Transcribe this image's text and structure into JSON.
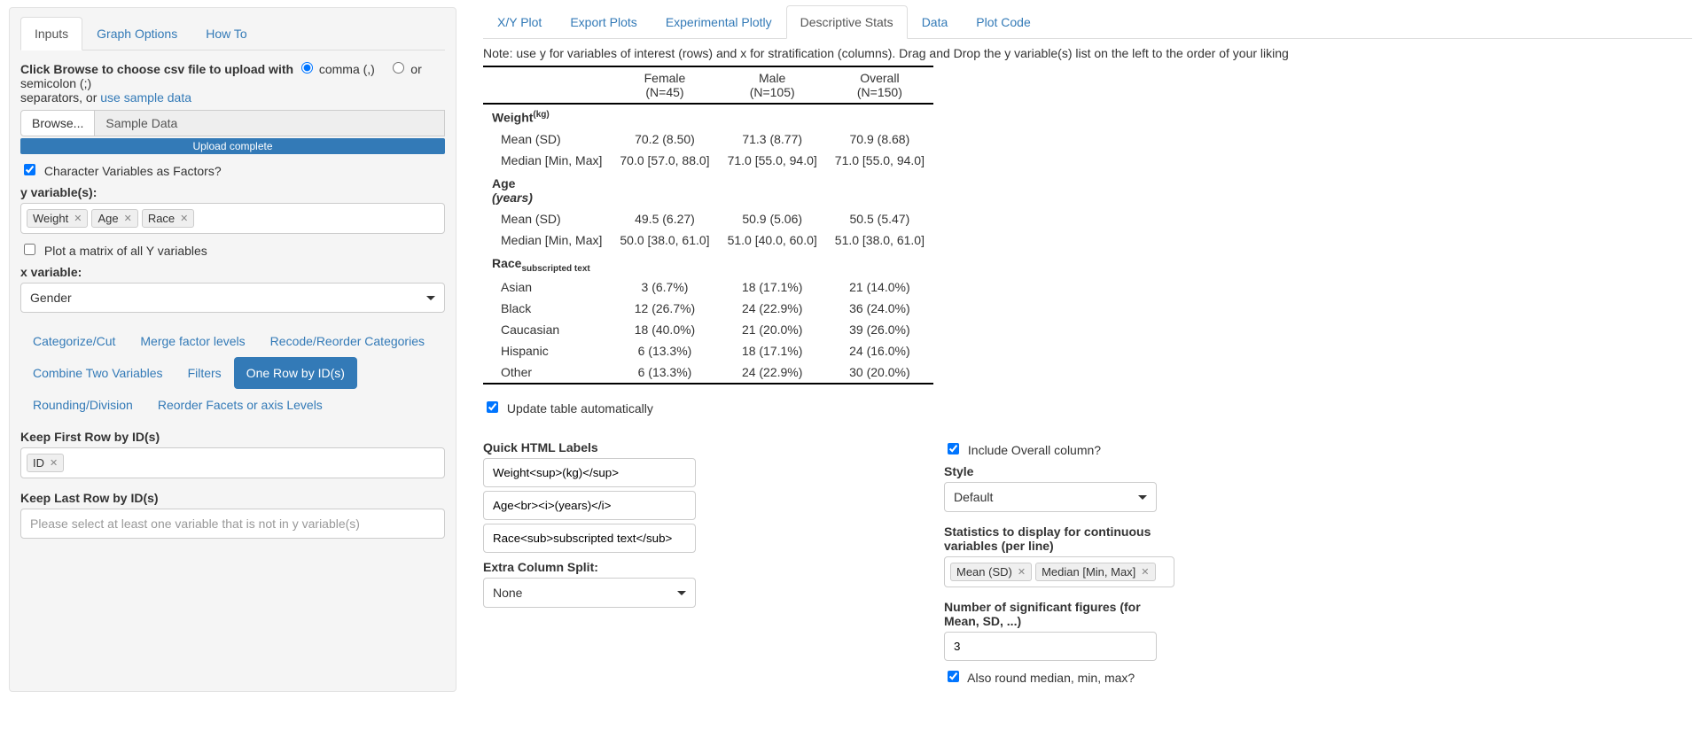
{
  "left": {
    "tabs": {
      "inputs": "Inputs",
      "graph": "Graph Options",
      "howto": "How To"
    },
    "instruction1": "Click Browse to choose csv file to upload with",
    "radio_comma": "comma (,)",
    "radio_semi": "or semicolon (;)",
    "instruction2": "separators, or ",
    "sample_link": "use sample data",
    "browse": "Browse...",
    "sample_data": "Sample Data",
    "upload_status": "Upload complete",
    "chk_factors": "Character Variables as Factors?",
    "yvars_label": "y variable(s):",
    "yvars": [
      "Weight",
      "Age",
      "Race"
    ],
    "chk_matrix": "Plot a matrix of all Y variables",
    "xvar_label": "x variable:",
    "xvar_value": "Gender",
    "subtabs": {
      "catcut": "Categorize/Cut",
      "merge": "Merge factor levels",
      "recode": "Recode/Reorder Categories",
      "combine": "Combine Two Variables",
      "filters": "Filters",
      "onerow": "One Row by ID(s)",
      "rounding": "Rounding/Division",
      "reorder": "Reorder Facets or axis Levels"
    },
    "keepfirst_label": "Keep First Row by ID(s)",
    "keepfirst_tokens": [
      "ID"
    ],
    "keeplast_label": "Keep Last Row by ID(s)",
    "keeplast_placeholder": "Please select at least one variable that is not in y variable(s)"
  },
  "right": {
    "main_tabs": {
      "xy": "X/Y Plot",
      "export": "Export Plots",
      "plotly": "Experimental Plotly",
      "stats": "Descriptive Stats",
      "data": "Data",
      "code": "Plot Code"
    },
    "note": "Note: use y for variables of interest (rows) and x for stratification (columns). Drag and Drop the y variable(s) list on the left to the order of your liking",
    "headers": {
      "female": "Female",
      "female_n": "(N=45)",
      "male": "Male",
      "male_n": "(N=105)",
      "overall": "Overall",
      "overall_n": "(N=150)"
    },
    "sections": [
      {
        "title_html": "Weight",
        "title_sup": "(kg)",
        "type": "cont",
        "rows": [
          {
            "label": "Mean (SD)",
            "f": "70.2 (8.50)",
            "m": "71.3 (8.77)",
            "o": "70.9 (8.68)"
          },
          {
            "label": "Median [Min, Max]",
            "f": "70.0 [57.0, 88.0]",
            "m": "71.0 [55.0, 94.0]",
            "o": "71.0 [55.0, 94.0]"
          }
        ]
      },
      {
        "title_html": "Age",
        "title_sub_italic": "(years)",
        "type": "cont",
        "rows": [
          {
            "label": "Mean (SD)",
            "f": "49.5 (6.27)",
            "m": "50.9 (5.06)",
            "o": "50.5 (5.47)"
          },
          {
            "label": "Median [Min, Max]",
            "f": "50.0 [38.0, 61.0]",
            "m": "51.0 [40.0, 60.0]",
            "o": "51.0 [38.0, 61.0]"
          }
        ]
      },
      {
        "title_html": "Race",
        "title_sub": "subscripted text",
        "type": "cat",
        "rows": [
          {
            "label": "Asian",
            "f": "3 (6.7%)",
            "m": "18 (17.1%)",
            "o": "21 (14.0%)"
          },
          {
            "label": "Black",
            "f": "12 (26.7%)",
            "m": "24 (22.9%)",
            "o": "36 (24.0%)"
          },
          {
            "label": "Caucasian",
            "f": "18 (40.0%)",
            "m": "21 (20.0%)",
            "o": "39 (26.0%)"
          },
          {
            "label": "Hispanic",
            "f": "6 (13.3%)",
            "m": "18 (17.1%)",
            "o": "24 (16.0%)"
          },
          {
            "label": "Other",
            "f": "6 (13.3%)",
            "m": "24 (22.9%)",
            "o": "30 (20.0%)"
          }
        ]
      }
    ],
    "chk_update": "Update table automatically",
    "quick_labels_title": "Quick HTML Labels",
    "quick_labels": [
      "Weight<sup>(kg)</sup>",
      "Age<br><i>(years)</i>",
      "Race<sub>subscripted text</sub>"
    ],
    "extra_split_label": "Extra Column Split:",
    "extra_split_value": "None",
    "chk_overall": "Include Overall column?",
    "style_label": "Style",
    "style_value": "Default",
    "stats_label": "Statistics to display for continuous variables (per line)",
    "stats_tokens": [
      "Mean (SD)",
      "Median [Min, Max]"
    ],
    "sig_label": "Number of significant figures (for Mean, SD, ...)",
    "sig_value": "3",
    "chk_round": "Also round median, min, max?"
  }
}
